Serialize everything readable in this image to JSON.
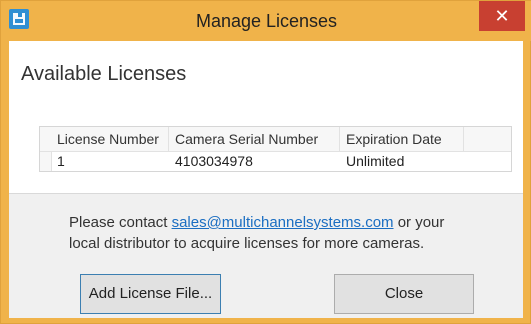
{
  "window": {
    "title": "Manage Licenses",
    "close_glyph": "✕"
  },
  "content": {
    "section_title": "Available Licenses",
    "table": {
      "headers": [
        "License Number",
        "Camera Serial Number",
        "Expiration Date"
      ],
      "rows": [
        [
          "1",
          "4103034978",
          "Unlimited"
        ]
      ]
    }
  },
  "footer": {
    "message_pre": "Please contact ",
    "message_link": "sales@multichannelsystems.com",
    "message_post": " or your local distributor to acquire licenses for more cameras.",
    "add_button": "Add License File...",
    "close_button": "Close"
  },
  "colors": {
    "titlebar": "#f0b34a",
    "close_button": "#c84031",
    "link": "#1b6ec2"
  },
  "icons": {
    "app": "app-icon",
    "close": "close-icon"
  }
}
